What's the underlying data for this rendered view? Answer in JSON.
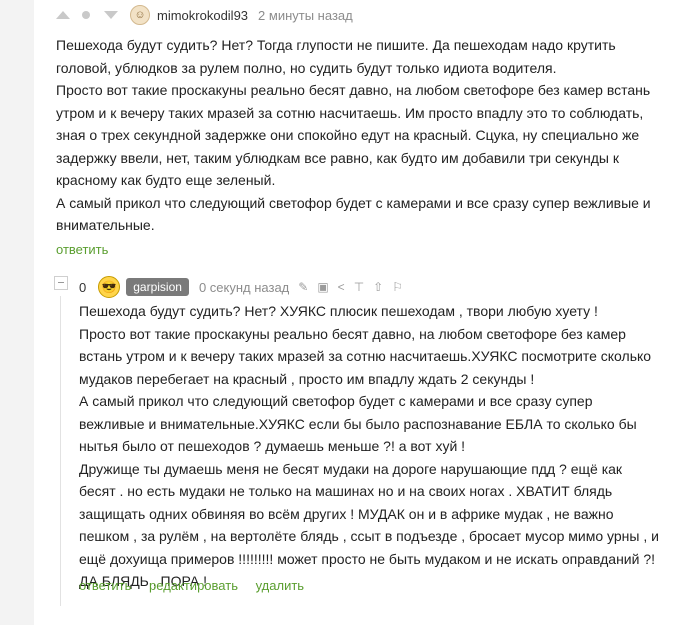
{
  "comment1": {
    "author": "mimokrokodil93",
    "time": "2 минуты назад",
    "paragraphs": [
      "Пешехода будут судить? Нет? Тогда глупости не пишите. Да пешеходам надо крутить головой, ублюдков за рулем полно, но судить будут только идиота водителя.",
      "Просто вот такие проскакуны реально бесят давно, на любом светофоре без камер встань утром и к вечеру таких мразей за сотню насчитаешь. Им просто впадлу это то соблюдать, зная о трех секундной задержке они спокойно едут на красный. Сцука, ну специально же задержку ввели, нет, таким ублюдкам все равно, как будто им добавили три секунды к красному как будто еще зеленый.",
      "А самый прикол что следующий светофор будет с камерами и все сразу супер вежливые и внимательные."
    ],
    "reply_label": "ответить"
  },
  "comment2": {
    "rating": "0",
    "author": "garpision",
    "time": "0 секунд назад",
    "paragraphs": [
      "Пешехода будут судить? Нет? ХУЯКС плюсик пешеходам , твори любую хуету !",
      "Просто вот такие проскакуны реально бесят давно, на любом светофоре без камер встань утром и к вечеру таких мразей за сотню насчитаешь.ХУЯКС посмотрите сколько мудаков перебегает на красный , просто им впадлу ждать 2 секунды !",
      "А самый прикол что следующий светофор будет с камерами и все сразу супер вежливые и внимательные.ХУЯКС если бы было распознавание ЕБЛА то сколько бы нытья было от пешеходов ? думаешь меньше ?! а вот хуй !",
      "Дружище ты думаешь меня не бесят мудаки на дороге нарушающие пдд ? ещё как бесят . но есть мудаки не только на машинах но и на своих ногах . ХВАТИТ блядь защищать одних обвиняя во всём других ! МУДАК он и в африке мудак , не важно пешком , за рулём , на вертолёте блядь , ссыт в подъезде , бросает мусор мимо урны , и ещё дохуища примеров !!!!!!!!! может просто не быть мудаком и не искать оправданий ?! ДА БЛЯДЬ , ПОРА !"
    ],
    "actions": [
      "ответить",
      "редактировать",
      "удалить"
    ]
  },
  "icons": [
    "upvote-icon",
    "dot-icon",
    "downvote-icon",
    "avatar-icon",
    "collapse-icon",
    "edit-icon",
    "save-icon",
    "share-icon",
    "pin-icon",
    "upload-icon",
    "report-icon"
  ],
  "colors": {
    "link": "#5a9e2f",
    "badge": "#7a7a7a",
    "muted": "#8c8c8c"
  }
}
